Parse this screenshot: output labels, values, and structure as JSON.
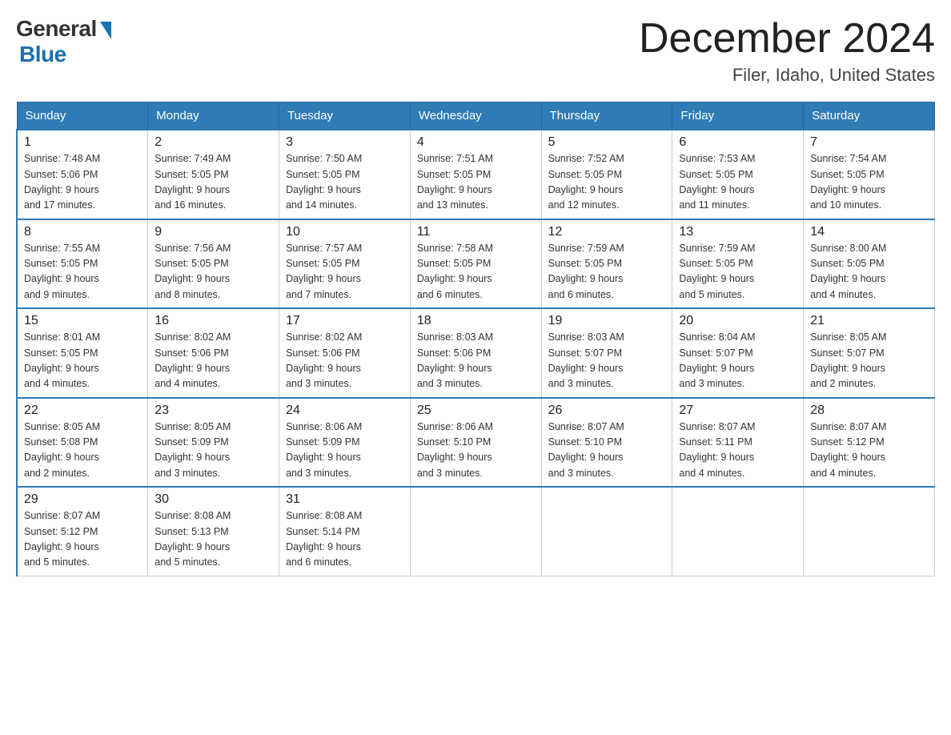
{
  "logo": {
    "general": "General",
    "blue": "Blue"
  },
  "title": {
    "month_year": "December 2024",
    "location": "Filer, Idaho, United States"
  },
  "days_of_week": [
    "Sunday",
    "Monday",
    "Tuesday",
    "Wednesday",
    "Thursday",
    "Friday",
    "Saturday"
  ],
  "weeks": [
    [
      {
        "day": "1",
        "sunrise": "7:48 AM",
        "sunset": "5:06 PM",
        "daylight": "9 hours and 17 minutes."
      },
      {
        "day": "2",
        "sunrise": "7:49 AM",
        "sunset": "5:05 PM",
        "daylight": "9 hours and 16 minutes."
      },
      {
        "day": "3",
        "sunrise": "7:50 AM",
        "sunset": "5:05 PM",
        "daylight": "9 hours and 14 minutes."
      },
      {
        "day": "4",
        "sunrise": "7:51 AM",
        "sunset": "5:05 PM",
        "daylight": "9 hours and 13 minutes."
      },
      {
        "day": "5",
        "sunrise": "7:52 AM",
        "sunset": "5:05 PM",
        "daylight": "9 hours and 12 minutes."
      },
      {
        "day": "6",
        "sunrise": "7:53 AM",
        "sunset": "5:05 PM",
        "daylight": "9 hours and 11 minutes."
      },
      {
        "day": "7",
        "sunrise": "7:54 AM",
        "sunset": "5:05 PM",
        "daylight": "9 hours and 10 minutes."
      }
    ],
    [
      {
        "day": "8",
        "sunrise": "7:55 AM",
        "sunset": "5:05 PM",
        "daylight": "9 hours and 9 minutes."
      },
      {
        "day": "9",
        "sunrise": "7:56 AM",
        "sunset": "5:05 PM",
        "daylight": "9 hours and 8 minutes."
      },
      {
        "day": "10",
        "sunrise": "7:57 AM",
        "sunset": "5:05 PM",
        "daylight": "9 hours and 7 minutes."
      },
      {
        "day": "11",
        "sunrise": "7:58 AM",
        "sunset": "5:05 PM",
        "daylight": "9 hours and 6 minutes."
      },
      {
        "day": "12",
        "sunrise": "7:59 AM",
        "sunset": "5:05 PM",
        "daylight": "9 hours and 6 minutes."
      },
      {
        "day": "13",
        "sunrise": "7:59 AM",
        "sunset": "5:05 PM",
        "daylight": "9 hours and 5 minutes."
      },
      {
        "day": "14",
        "sunrise": "8:00 AM",
        "sunset": "5:05 PM",
        "daylight": "9 hours and 4 minutes."
      }
    ],
    [
      {
        "day": "15",
        "sunrise": "8:01 AM",
        "sunset": "5:05 PM",
        "daylight": "9 hours and 4 minutes."
      },
      {
        "day": "16",
        "sunrise": "8:02 AM",
        "sunset": "5:06 PM",
        "daylight": "9 hours and 4 minutes."
      },
      {
        "day": "17",
        "sunrise": "8:02 AM",
        "sunset": "5:06 PM",
        "daylight": "9 hours and 3 minutes."
      },
      {
        "day": "18",
        "sunrise": "8:03 AM",
        "sunset": "5:06 PM",
        "daylight": "9 hours and 3 minutes."
      },
      {
        "day": "19",
        "sunrise": "8:03 AM",
        "sunset": "5:07 PM",
        "daylight": "9 hours and 3 minutes."
      },
      {
        "day": "20",
        "sunrise": "8:04 AM",
        "sunset": "5:07 PM",
        "daylight": "9 hours and 3 minutes."
      },
      {
        "day": "21",
        "sunrise": "8:05 AM",
        "sunset": "5:07 PM",
        "daylight": "9 hours and 2 minutes."
      }
    ],
    [
      {
        "day": "22",
        "sunrise": "8:05 AM",
        "sunset": "5:08 PM",
        "daylight": "9 hours and 2 minutes."
      },
      {
        "day": "23",
        "sunrise": "8:05 AM",
        "sunset": "5:09 PM",
        "daylight": "9 hours and 3 minutes."
      },
      {
        "day": "24",
        "sunrise": "8:06 AM",
        "sunset": "5:09 PM",
        "daylight": "9 hours and 3 minutes."
      },
      {
        "day": "25",
        "sunrise": "8:06 AM",
        "sunset": "5:10 PM",
        "daylight": "9 hours and 3 minutes."
      },
      {
        "day": "26",
        "sunrise": "8:07 AM",
        "sunset": "5:10 PM",
        "daylight": "9 hours and 3 minutes."
      },
      {
        "day": "27",
        "sunrise": "8:07 AM",
        "sunset": "5:11 PM",
        "daylight": "9 hours and 4 minutes."
      },
      {
        "day": "28",
        "sunrise": "8:07 AM",
        "sunset": "5:12 PM",
        "daylight": "9 hours and 4 minutes."
      }
    ],
    [
      {
        "day": "29",
        "sunrise": "8:07 AM",
        "sunset": "5:12 PM",
        "daylight": "9 hours and 5 minutes."
      },
      {
        "day": "30",
        "sunrise": "8:08 AM",
        "sunset": "5:13 PM",
        "daylight": "9 hours and 5 minutes."
      },
      {
        "day": "31",
        "sunrise": "8:08 AM",
        "sunset": "5:14 PM",
        "daylight": "9 hours and 6 minutes."
      },
      null,
      null,
      null,
      null
    ]
  ],
  "labels": {
    "sunrise": "Sunrise:",
    "sunset": "Sunset:",
    "daylight": "Daylight:"
  }
}
